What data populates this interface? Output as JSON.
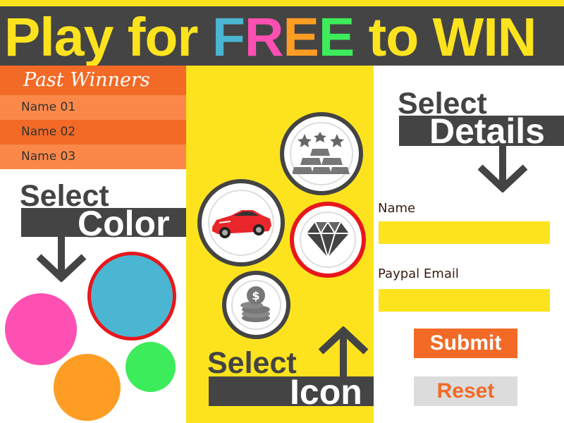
{
  "header": {
    "title_prefix": "Play for ",
    "title_letters": [
      {
        "char": "F",
        "color": "#4bb6d2"
      },
      {
        "char": "R",
        "color": "#fe4fb2"
      },
      {
        "char": "E",
        "color": "#fe9d23"
      },
      {
        "char": "E",
        "color": "#3dec5b"
      }
    ],
    "title_suffix": " to WIN"
  },
  "winners": {
    "heading": "Past Winners",
    "names": [
      "Name 01",
      "Name 02",
      "Name 03"
    ]
  },
  "color_section": {
    "select_word": "Select",
    "target_word": "Color",
    "colors": [
      {
        "name": "pink",
        "hex": "#fe4fb2",
        "selected": false
      },
      {
        "name": "blue",
        "hex": "#4bb6d2",
        "selected": true
      },
      {
        "name": "orange",
        "hex": "#fe9d23",
        "selected": false
      },
      {
        "name": "green",
        "hex": "#3dec5b",
        "selected": false
      }
    ]
  },
  "icon_section": {
    "select_word": "Select",
    "target_word": "Icon",
    "icons": [
      {
        "name": "gold-bars-icon",
        "selected": false
      },
      {
        "name": "sports-car-icon",
        "selected": false
      },
      {
        "name": "diamond-icon",
        "selected": true
      },
      {
        "name": "coins-icon",
        "selected": false
      }
    ]
  },
  "details_section": {
    "select_word": "Select",
    "target_word": "Details"
  },
  "form": {
    "name_label": "Name",
    "name_value": "",
    "email_label": "Paypal Email",
    "email_value": "",
    "submit_label": "Submit",
    "reset_label": "Reset"
  },
  "palette": {
    "yellow": "#fde31e",
    "dark": "#444444",
    "orange": "#f26a26",
    "selected_ring": "#e8171c"
  }
}
